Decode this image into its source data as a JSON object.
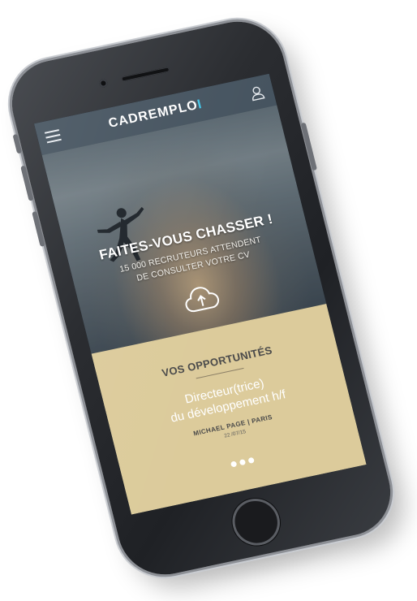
{
  "header": {
    "logo_main": "CADREMPLO",
    "logo_accent": "I",
    "menu_icon": "hamburger-menu-icon",
    "user_icon": "user-icon"
  },
  "hero": {
    "title": "FAITES-VOUS CHASSER !",
    "subtitle_line1": "15 000 RECRUTEURS ATTENDENT",
    "subtitle_line2": "DE CONSULTER VOTRE CV",
    "upload_icon": "cloud-upload-icon"
  },
  "opportunities": {
    "title": "VOS OPPORTUNITÉS",
    "job_title_line1": "Directeur(trice)",
    "job_title_line2": "du développement h/f",
    "company": "MICHAEL PAGE | PARIS",
    "date": "22 /07/15",
    "dots_count": 3
  },
  "colors": {
    "header_bg": "#485662",
    "logo_accent": "#43c6e8",
    "opportunities_bg": "#dccb9b",
    "phone_body": "#2b2d31"
  }
}
